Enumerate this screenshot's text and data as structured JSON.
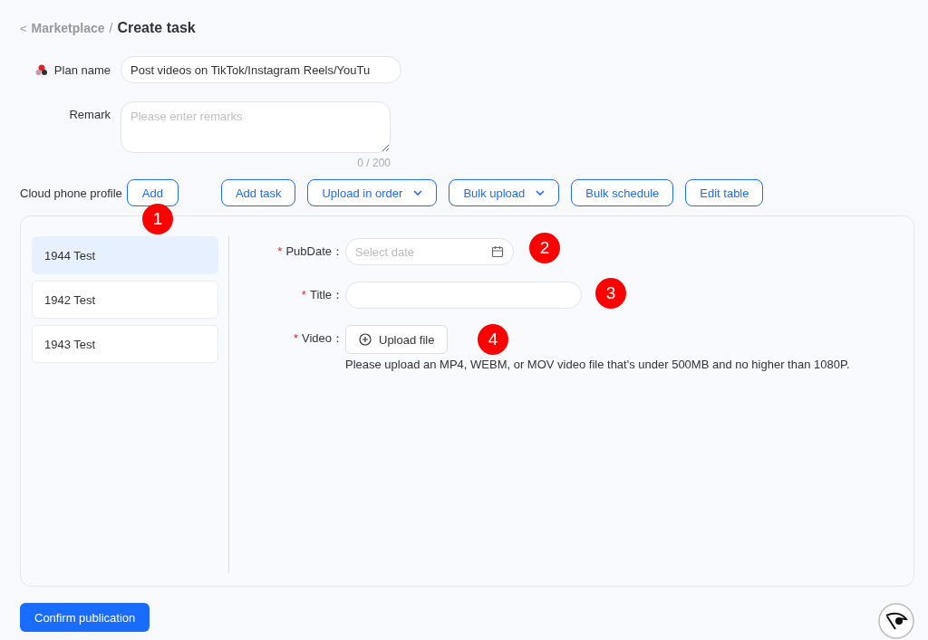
{
  "breadcrumb": {
    "back": "<",
    "parent": "Marketplace",
    "separator": "/",
    "current": "Create task"
  },
  "plan_name": {
    "label": "Plan name",
    "value": "Post videos on TikTok/Instagram Reels/YouTu"
  },
  "remark": {
    "label": "Remark",
    "placeholder": "Please enter remarks",
    "counter": "0 / 200"
  },
  "profile": {
    "label": "Cloud phone profile",
    "add": "Add"
  },
  "toolbar": [
    {
      "label": "Add task",
      "dropdown": false
    },
    {
      "label": "Upload in order",
      "dropdown": true
    },
    {
      "label": "Bulk upload",
      "dropdown": true
    },
    {
      "label": "Bulk schedule",
      "dropdown": false
    },
    {
      "label": "Edit table",
      "dropdown": false
    }
  ],
  "profiles": [
    {
      "name": "1944 Test",
      "selected": true
    },
    {
      "name": "1942 Test",
      "selected": false
    },
    {
      "name": "1943 Test",
      "selected": false
    }
  ],
  "required_symbol": "*",
  "form": [
    {
      "kind": "date",
      "label": "PubDate：",
      "required": true,
      "placeholder": "Select date"
    },
    {
      "kind": "text",
      "label": "Title：",
      "required": true
    },
    {
      "kind": "upload",
      "label": "Video：",
      "required": true,
      "button": "Upload file",
      "hint": "Please upload an MP4, WEBM, or MOV video file that's under 500MB and no higher than 1080P."
    }
  ],
  "markers": [
    "1",
    "2",
    "3",
    "4"
  ],
  "confirm": "Confirm publication"
}
